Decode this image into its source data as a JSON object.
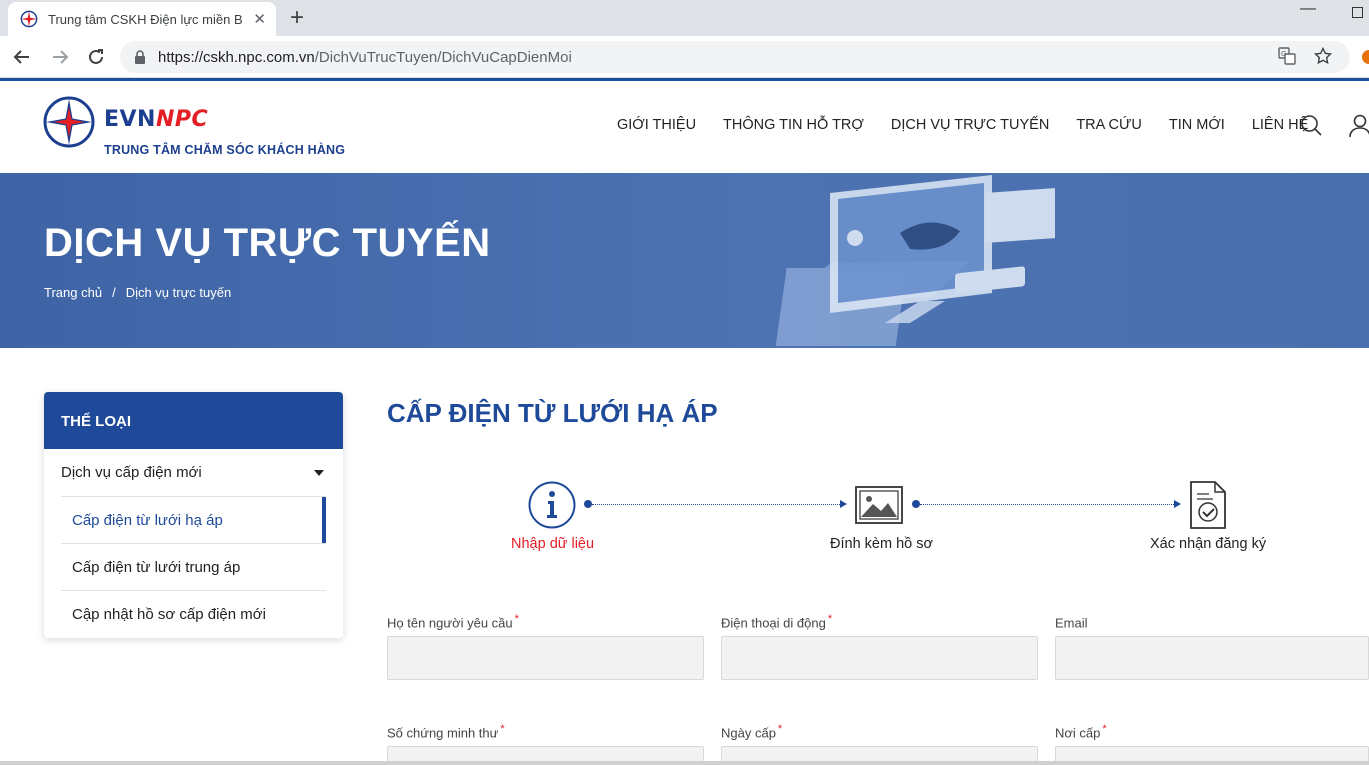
{
  "browser": {
    "tab_title": "Trung tâm CSKH Điện lực miền B",
    "url_host": "https://cskh.npc.com.vn",
    "url_path": "/DichVuTrucTuyen/DichVuCapDienMoi"
  },
  "header": {
    "logo_evn": "EVN",
    "logo_npc": "NPC",
    "logo_sub": "TRUNG TÂM CHĂM SÓC KHÁCH HÀNG",
    "nav": [
      "GIỚI THIỆU",
      "THÔNG TIN HỖ TRỢ",
      "DỊCH VỤ TRỰC TUYẾN",
      "TRA CỨU",
      "TIN MỚI",
      "LIÊN HỆ"
    ]
  },
  "hero": {
    "title": "DỊCH VỤ TRỰC TUYẾN",
    "breadcrumb": [
      "Trang chủ",
      "Dịch vụ trực tuyến"
    ],
    "breadcrumb_sep": "/"
  },
  "sidebar": {
    "heading": "THỂ LOẠI",
    "group": "Dịch vụ cấp điện mới",
    "items": [
      "Cấp điện từ lưới hạ áp",
      "Cấp điện từ lưới trung áp",
      "Cập nhật hồ sơ cấp điện mới"
    ]
  },
  "main": {
    "title": "CẤP ĐIỆN TỪ LƯỚI HẠ ÁP",
    "steps": [
      {
        "label": "Nhập dữ liệu",
        "state": "active"
      },
      {
        "label": "Đính kèm hồ sơ",
        "state": "pending"
      },
      {
        "label": "Xác nhận đăng ký",
        "state": "pending"
      }
    ],
    "fields": [
      {
        "label": "Họ tên người yêu cầu",
        "required": "*",
        "value": ""
      },
      {
        "label": "Điện thoại di động",
        "required": "*",
        "value": ""
      },
      {
        "label": "Email",
        "required": "",
        "value": ""
      },
      {
        "label": "Số chứng minh thư",
        "required": "*",
        "value": ""
      },
      {
        "label": "Ngày cấp",
        "required": "*",
        "value": ""
      },
      {
        "label": "Nơi cấp",
        "required": "*",
        "value": ""
      }
    ]
  },
  "colors": {
    "brand_blue": "#1e4a99",
    "active_step": "#e31e24",
    "hero_bg": "#4d73b3"
  }
}
